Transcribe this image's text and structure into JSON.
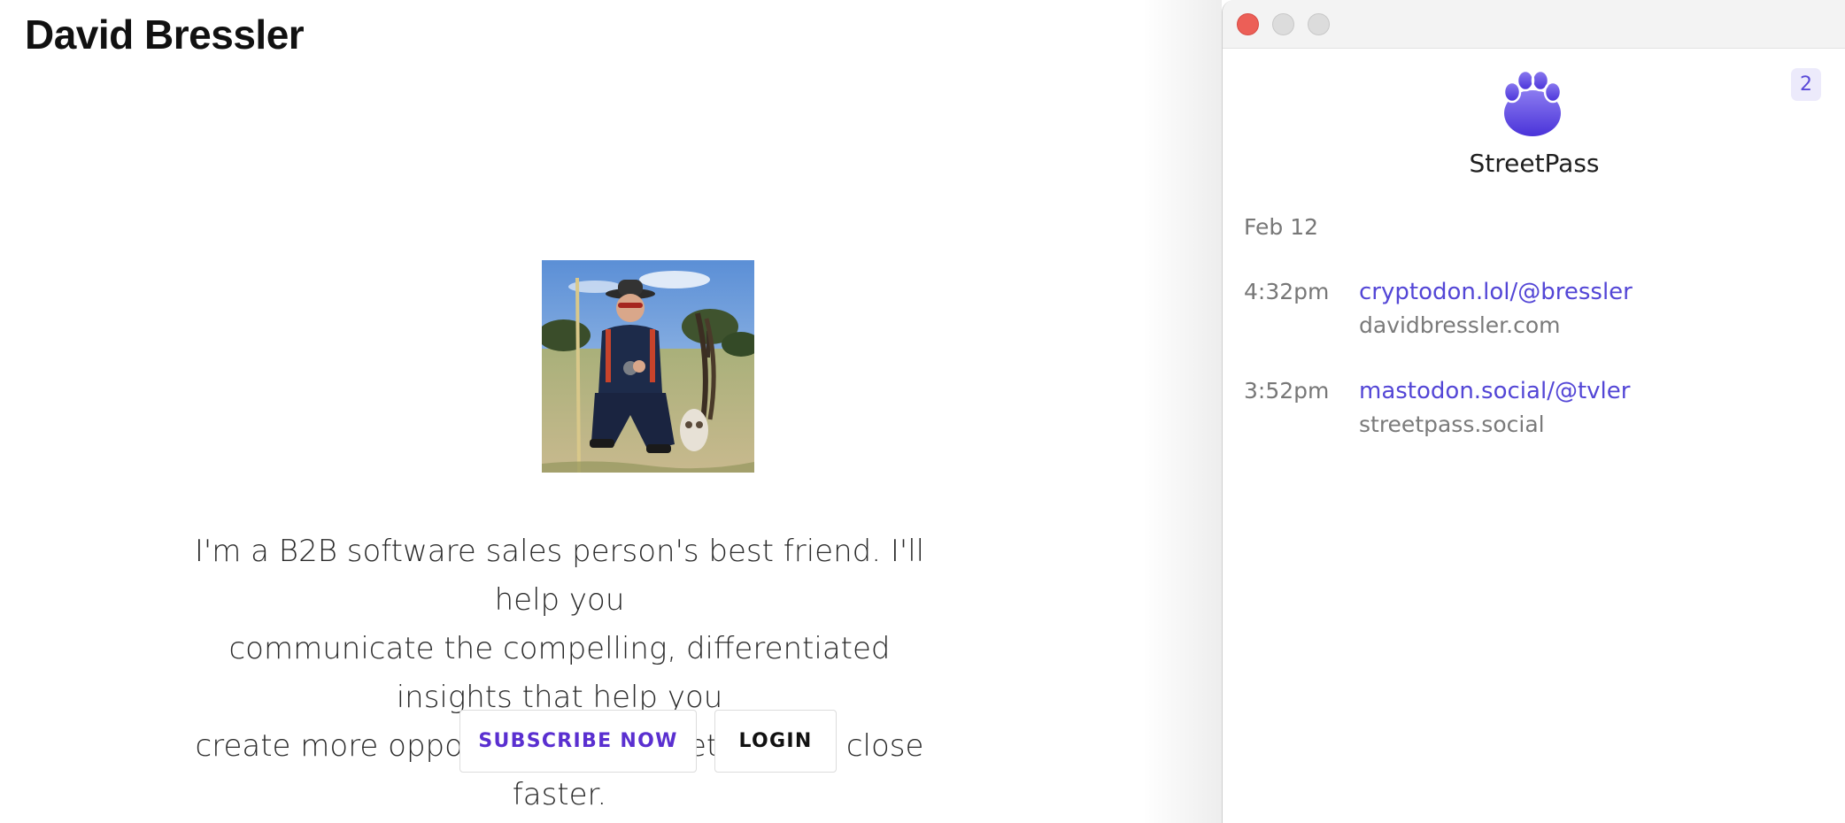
{
  "site": {
    "title": "David Bressler",
    "bio_lines": [
      "I'm a B2B software sales person's best friend. I'll help you",
      "communicate the compelling, differentiated insights that help you",
      "create more opportunities, win better, and close faster."
    ],
    "subscribe_label": "SUBSCRIBE NOW",
    "login_label": "LOGIN",
    "accent_color": "#5a2fd0"
  },
  "app": {
    "name": "StreetPass",
    "badge_count": "2",
    "icon": "paw-icon",
    "accent_color": "#5346d6",
    "date_group": "Feb 12",
    "entries": [
      {
        "time": "4:32pm",
        "handle": "cryptodon.lol/@bressler",
        "site": "davidbressler.com"
      },
      {
        "time": "3:52pm",
        "handle": "mastodon.social/@tvler",
        "site": "streetpass.social"
      }
    ]
  }
}
